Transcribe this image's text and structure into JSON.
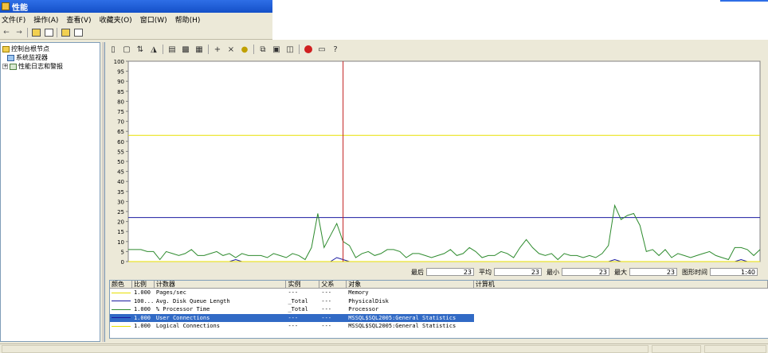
{
  "window": {
    "title": "性能"
  },
  "menu": [
    "文件(F)",
    "操作(A)",
    "查看(V)",
    "收藏夹(O)",
    "窗口(W)",
    "帮助(H)"
  ],
  "tree": {
    "root": "控制台根节点",
    "children": [
      "系统监视器",
      "性能日志和警报"
    ]
  },
  "chart_data": {
    "type": "line",
    "ylim": [
      0,
      100
    ],
    "yticks": [
      0,
      5,
      10,
      15,
      20,
      25,
      30,
      35,
      40,
      45,
      50,
      55,
      60,
      65,
      70,
      75,
      80,
      85,
      90,
      95,
      100
    ],
    "grid": false,
    "cursor_sample": 34,
    "series": [
      {
        "name": "Pages/sec",
        "color": "#e8e000",
        "values": [
          63,
          63,
          63,
          63,
          63,
          63,
          63,
          63,
          63,
          63,
          63,
          63,
          63,
          63,
          63,
          63,
          63,
          63,
          63,
          63,
          63,
          63,
          63,
          63,
          63,
          63,
          63,
          63,
          63,
          63,
          63,
          63,
          63,
          63,
          63,
          63,
          63,
          63,
          63,
          63,
          63,
          63,
          63,
          63,
          63,
          63,
          63,
          63,
          63,
          63,
          63,
          63,
          63,
          63,
          63,
          63,
          63,
          63,
          63,
          63,
          63,
          63,
          63,
          63,
          63,
          63,
          63,
          63,
          63,
          63,
          63,
          63,
          63,
          63,
          63,
          63,
          63,
          63,
          63,
          63,
          63,
          63,
          63,
          63,
          63,
          63,
          63,
          63,
          63,
          63,
          63,
          63,
          63,
          63,
          63,
          63,
          63,
          63,
          63,
          63,
          63
        ]
      },
      {
        "name": "Avg. Disk Queue Length",
        "color": "#1a1aa0",
        "values": [
          22,
          22,
          22,
          22,
          22,
          22,
          22,
          22,
          22,
          22,
          22,
          22,
          22,
          22,
          22,
          22,
          22,
          22,
          22,
          22,
          22,
          22,
          22,
          22,
          22,
          22,
          22,
          22,
          22,
          22,
          22,
          22,
          22,
          22,
          22,
          22,
          22,
          22,
          22,
          22,
          22,
          22,
          22,
          22,
          22,
          22,
          22,
          22,
          22,
          22,
          22,
          22,
          22,
          22,
          22,
          22,
          22,
          22,
          22,
          22,
          22,
          22,
          22,
          22,
          22,
          22,
          22,
          22,
          22,
          22,
          22,
          22,
          22,
          22,
          22,
          22,
          22,
          22,
          22,
          22,
          22,
          22,
          22,
          22,
          22,
          22,
          22,
          22,
          22,
          22,
          22,
          22,
          22,
          22,
          22,
          22,
          22,
          22,
          22,
          22,
          22
        ]
      },
      {
        "name": "% Processor Time",
        "color": "#2e8b2e",
        "values": [
          6,
          6,
          6,
          5,
          5,
          1,
          5,
          4,
          3,
          4,
          6,
          3,
          3,
          4,
          5,
          3,
          4,
          2,
          4,
          3,
          3,
          3,
          2,
          4,
          3,
          2,
          4,
          3,
          1,
          7,
          24,
          7,
          13,
          19,
          10,
          8,
          2,
          4,
          5,
          3,
          4,
          6,
          6,
          5,
          2,
          4,
          4,
          3,
          2,
          3,
          4,
          6,
          3,
          4,
          7,
          5,
          2,
          3,
          3,
          5,
          4,
          2,
          7,
          11,
          7,
          4,
          3,
          4,
          1,
          4,
          3,
          3,
          2,
          3,
          2,
          4,
          8,
          28,
          21,
          23,
          24,
          18,
          5,
          6,
          3,
          6,
          2,
          4,
          3,
          2,
          3,
          4,
          5,
          3,
          2,
          1,
          7,
          7,
          6,
          3,
          6
        ]
      },
      {
        "name": "User Connections",
        "color": "#1a1aa0",
        "values": [
          0,
          0,
          0,
          0,
          0,
          0,
          0,
          0,
          0,
          0,
          0,
          0,
          0,
          0,
          0,
          0,
          0,
          1,
          0,
          0,
          0,
          0,
          0,
          0,
          0,
          0,
          0,
          0,
          0,
          0,
          0,
          0,
          0,
          2,
          1,
          0,
          0,
          0,
          0,
          0,
          0,
          0,
          0,
          0,
          0,
          0,
          0,
          0,
          0,
          0,
          0,
          0,
          0,
          0,
          0,
          0,
          0,
          0,
          0,
          0,
          0,
          0,
          0,
          0,
          0,
          0,
          0,
          0,
          0,
          0,
          0,
          0,
          0,
          0,
          0,
          0,
          0,
          1,
          0,
          0,
          0,
          0,
          0,
          0,
          0,
          0,
          0,
          0,
          0,
          0,
          0,
          0,
          0,
          0,
          0,
          0,
          0,
          1,
          0,
          0,
          0
        ]
      },
      {
        "name": "Logical Connections",
        "color": "#e8e000",
        "values": [
          0,
          0,
          0,
          0,
          0,
          0,
          0,
          0,
          0,
          0,
          0,
          0,
          0,
          0,
          0,
          0,
          0,
          0,
          0,
          0,
          0,
          0,
          0,
          0,
          0,
          0,
          0,
          0,
          0,
          0,
          0,
          0,
          0,
          0,
          0,
          0,
          0,
          0,
          0,
          0,
          0,
          0,
          0,
          0,
          0,
          0,
          0,
          0,
          0,
          0,
          0,
          0,
          0,
          0,
          0,
          0,
          0,
          0,
          0,
          0,
          0,
          0,
          0,
          0,
          0,
          0,
          0,
          0,
          0,
          0,
          0,
          0,
          0,
          0,
          0,
          0,
          0,
          0,
          0,
          0,
          0,
          0,
          0,
          0,
          0,
          0,
          0,
          0,
          0,
          0,
          0,
          0,
          0,
          0,
          0,
          0,
          0,
          0,
          0,
          0,
          0
        ]
      }
    ]
  },
  "stats": {
    "last_label": "最后",
    "last": "23",
    "avg_label": "平均",
    "avg": "23",
    "min_label": "最小",
    "min": "23",
    "max_label": "最大",
    "max": "23",
    "duration_label": "图形时间",
    "duration": "1:40"
  },
  "table": {
    "headers": [
      "颜色",
      "比例",
      "计数器",
      "实例",
      "父系",
      "对象",
      "计算机"
    ],
    "rows": [
      {
        "color": "#e8e000",
        "scale": "1.000",
        "counter": "Pages/sec",
        "instance": "---",
        "parent": "---",
        "object": "Memory",
        "computer": ""
      },
      {
        "color": "#1a1aa0",
        "scale": "100...",
        "counter": "Avg. Disk Queue Length",
        "instance": "_Total",
        "parent": "---",
        "object": "PhysicalDisk",
        "computer": ""
      },
      {
        "color": "#2e8b2e",
        "scale": "1.000",
        "counter": "% Processor Time",
        "instance": "_Total",
        "parent": "---",
        "object": "Processor",
        "computer": ""
      },
      {
        "color": "#1a1aa0",
        "scale": "1.000",
        "counter": "User Connections",
        "instance": "---",
        "parent": "---",
        "object": "MSSQL$SQL2005:General Statistics",
        "computer": ""
      },
      {
        "color": "#e8e000",
        "scale": "1.000",
        "counter": "Logical Connections",
        "instance": "---",
        "parent": "---",
        "object": "MSSQL$SQL2005:General Statistics",
        "computer": ""
      }
    ]
  }
}
